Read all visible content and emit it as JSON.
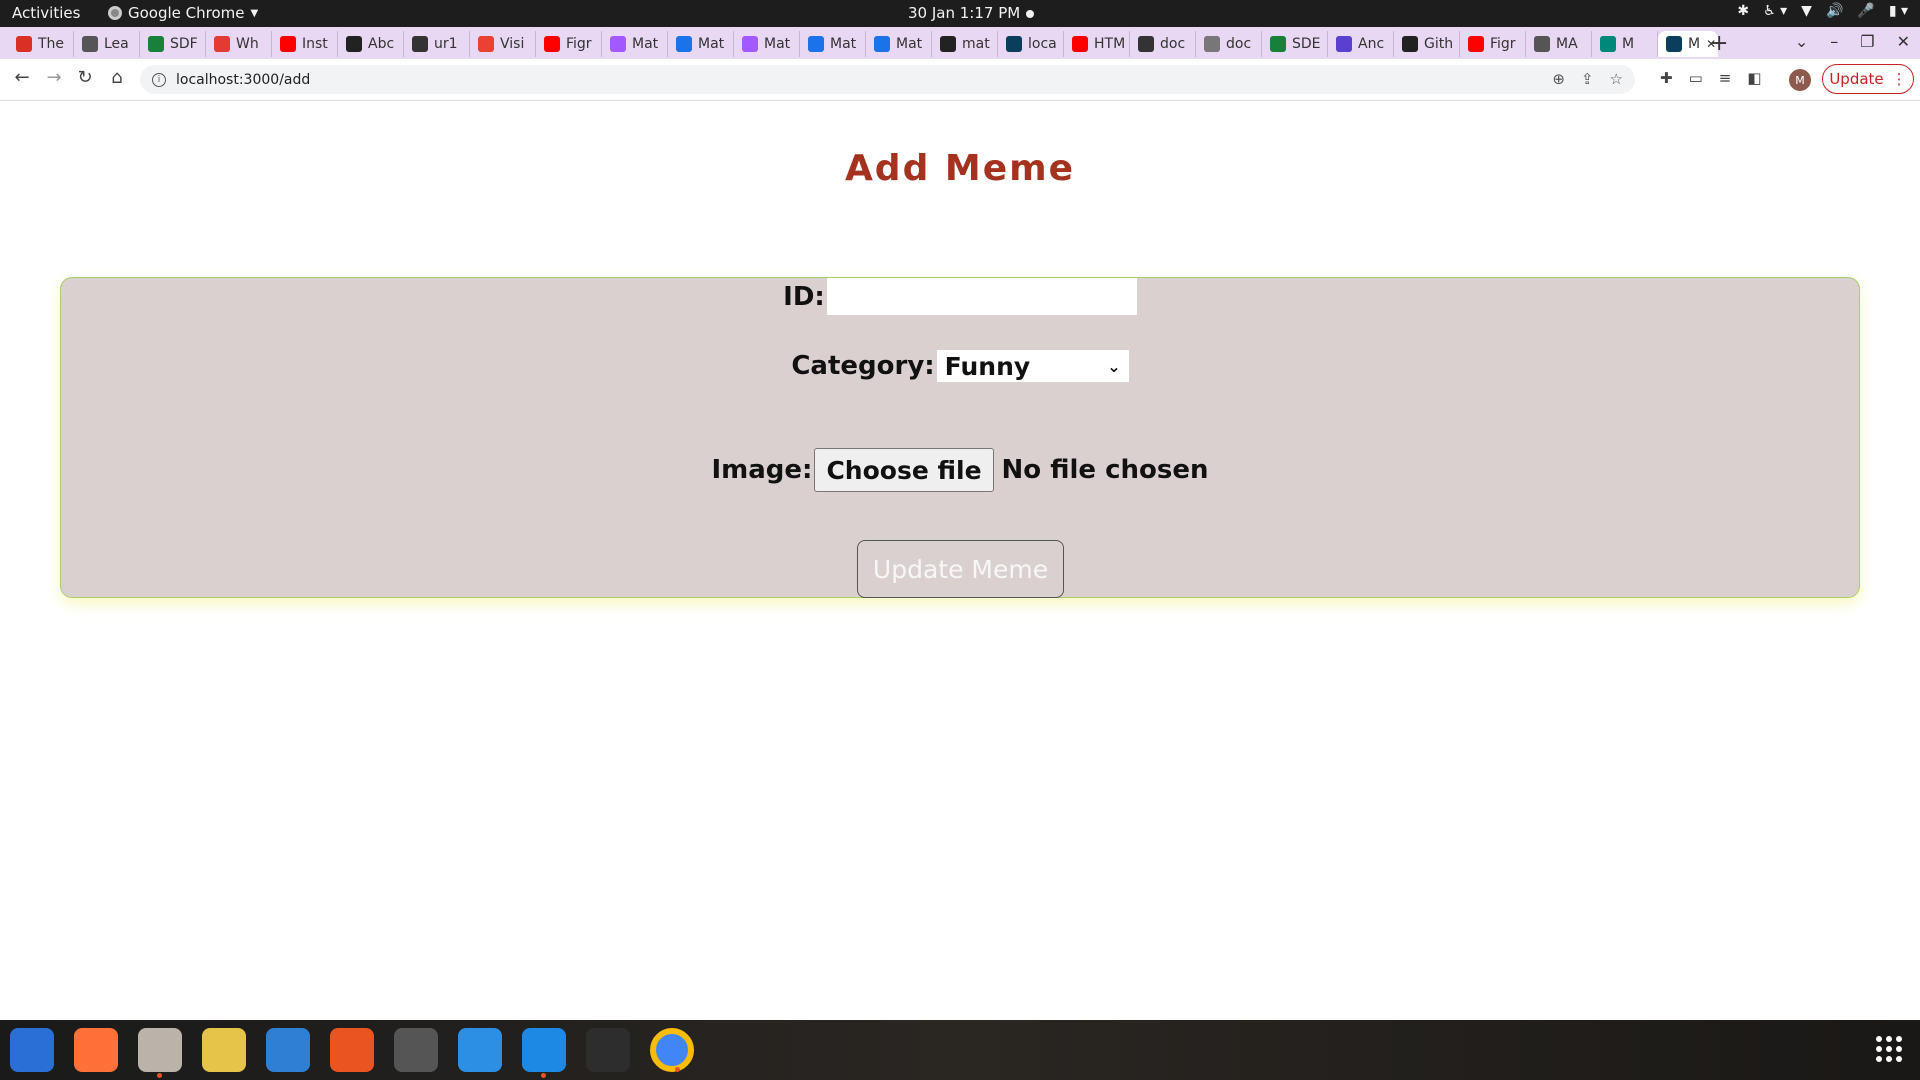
{
  "system_bar": {
    "activities": "Activities",
    "app_name": "Google Chrome",
    "clock": "30 Jan  1:17 PM"
  },
  "tabs": [
    {
      "label": "The",
      "icon": "gmail-icon",
      "color": "#d93025"
    },
    {
      "label": "Lea",
      "icon": "circle-x-icon",
      "color": "#555555"
    },
    {
      "label": "SDF",
      "icon": "sheets-icon",
      "color": "#188038"
    },
    {
      "label": "Wh",
      "icon": "dashed-circle-icon",
      "color": "#e53935"
    },
    {
      "label": "Inst",
      "icon": "youtube-icon",
      "color": "#ff0000"
    },
    {
      "label": "Abc",
      "icon": "github-icon",
      "color": "#222222"
    },
    {
      "label": "ur1",
      "icon": "doc-icon",
      "color": "#333333"
    },
    {
      "label": "Visi",
      "icon": "diamond-icon",
      "color": "#e94235"
    },
    {
      "label": "Figr",
      "icon": "youtube-icon",
      "color": "#ff0000"
    },
    {
      "label": "Mat",
      "icon": "figma-icon",
      "color": "#a259ff"
    },
    {
      "label": "Mat",
      "icon": "code-icon",
      "color": "#1a73e8"
    },
    {
      "label": "Mat",
      "icon": "figma-icon",
      "color": "#a259ff"
    },
    {
      "label": "Mat",
      "icon": "code-icon",
      "color": "#1a73e8"
    },
    {
      "label": "Mat",
      "icon": "code-icon",
      "color": "#1a73e8"
    },
    {
      "label": "mat",
      "icon": "github-icon",
      "color": "#222222"
    },
    {
      "label": "loca",
      "icon": "react-icon",
      "color": "#0b3d5c"
    },
    {
      "label": "HTM",
      "icon": "youtube-icon",
      "color": "#ff0000"
    },
    {
      "label": "doc",
      "icon": "notion-icon",
      "color": "#333333"
    },
    {
      "label": "doc",
      "icon": "docs-icon",
      "color": "#777777"
    },
    {
      "label": "SDE",
      "icon": "sheets-icon",
      "color": "#188038"
    },
    {
      "label": "Anc",
      "icon": "app-icon",
      "color": "#5a3fd1"
    },
    {
      "label": "Gith",
      "icon": "github-icon",
      "color": "#222222"
    },
    {
      "label": "Figr",
      "icon": "youtube-icon",
      "color": "#ff0000"
    },
    {
      "label": "MA",
      "icon": "globe-icon",
      "color": "#555555"
    },
    {
      "label": "M",
      "icon": "meet-icon",
      "color": "#00897b"
    },
    {
      "label": "M",
      "icon": "react-icon",
      "color": "#0b3d5c",
      "active": true
    }
  ],
  "toolbar": {
    "url": "localhost:3000/add",
    "update_label": "Update",
    "avatar_initial": "M"
  },
  "page": {
    "title": "Add Meme",
    "form": {
      "id_label": "ID:",
      "id_value": "",
      "category_label": "Category:",
      "category_selected": "Funny",
      "image_label": "Image:",
      "file_button": "Choose file",
      "file_status": "No file chosen",
      "submit_label": "Update Meme"
    }
  },
  "colors": {
    "title": "#a5321f",
    "card_bg": "#dbd0d0",
    "card_border": "#a9cf6b",
    "tabstrip": "#e9d8f3"
  },
  "dock": [
    {
      "name": "thunderbird-icon",
      "color": "#2a6fd6",
      "running": false
    },
    {
      "name": "firefox-icon",
      "color": "#ff7139",
      "running": false
    },
    {
      "name": "files-icon",
      "color": "#b9b3a9",
      "running": true
    },
    {
      "name": "rhythmbox-icon",
      "color": "#e6c44a",
      "running": false
    },
    {
      "name": "writer-icon",
      "color": "#2f7fd4",
      "running": false
    },
    {
      "name": "software-icon",
      "color": "#e95420",
      "running": false
    },
    {
      "name": "usb-creator-icon",
      "color": "#555555",
      "running": false
    },
    {
      "name": "help-icon",
      "color": "#2d8fe3",
      "running": false
    },
    {
      "name": "vscode-icon",
      "color": "#1e88e5",
      "running": true
    },
    {
      "name": "terminal-icon",
      "color": "#2d2d2d",
      "running": false
    },
    {
      "name": "chrome-icon",
      "color": "#4285f4",
      "running": true
    }
  ]
}
